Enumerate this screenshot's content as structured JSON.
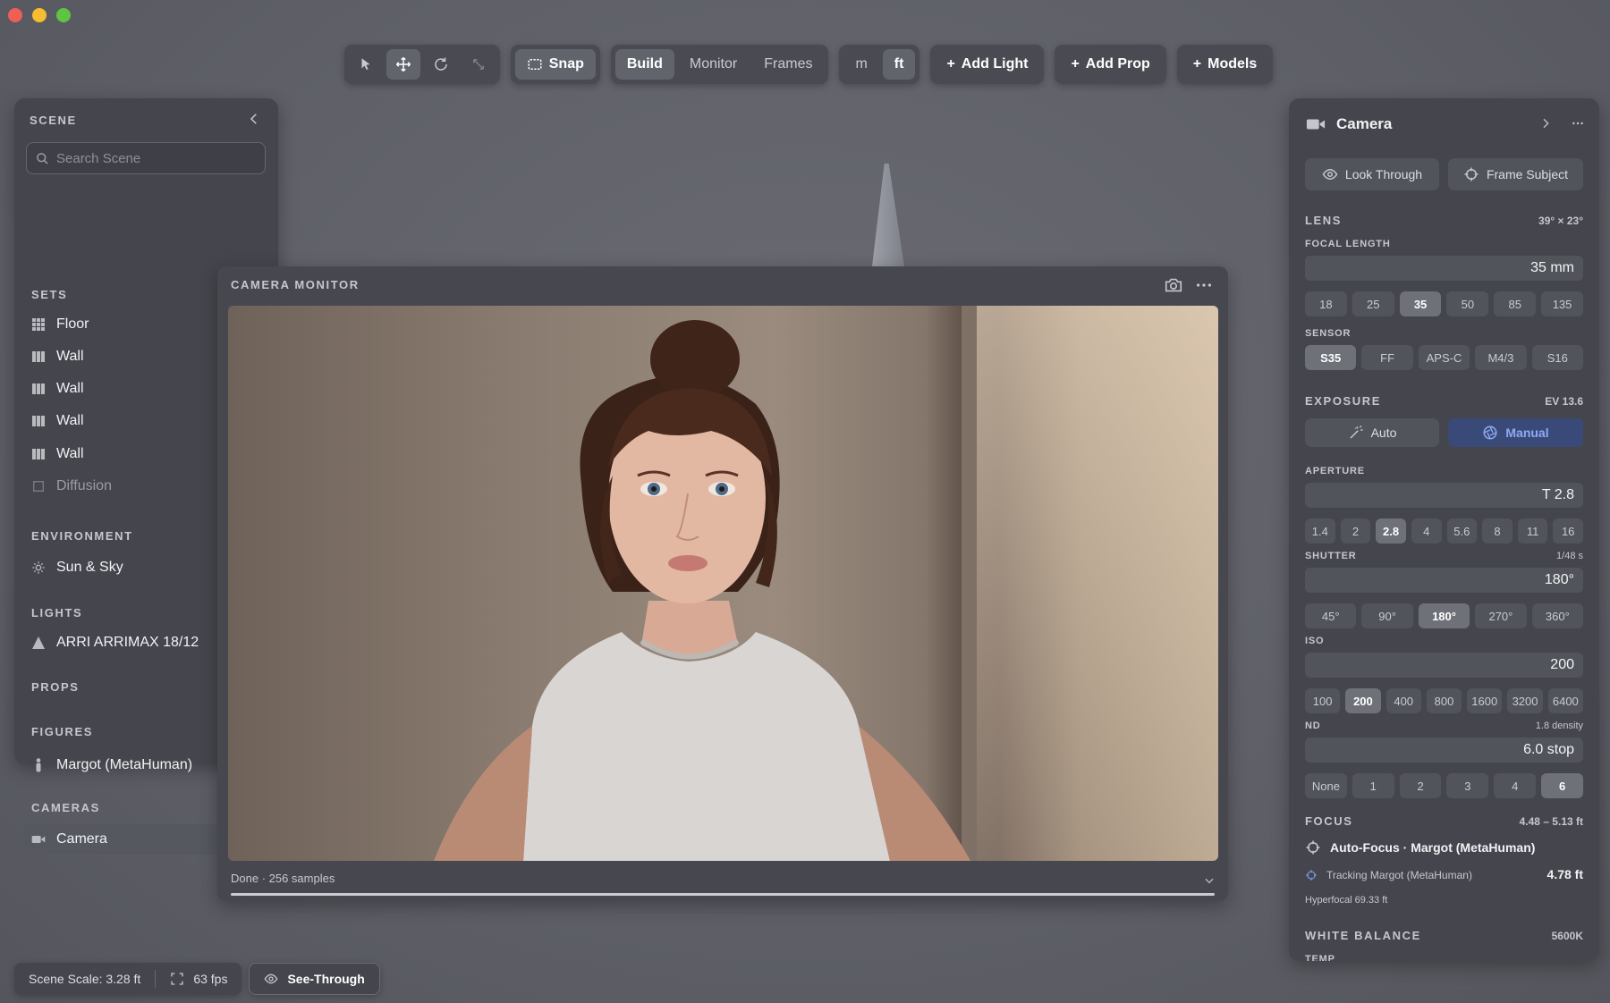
{
  "toolbar": {
    "tools": [
      {
        "name": "select",
        "icon": "cursor-arrow-icon"
      },
      {
        "name": "move",
        "icon": "move-arrows-icon"
      },
      {
        "name": "rotate",
        "icon": "rotate-icon"
      },
      {
        "name": "scale",
        "icon": "scale-icon"
      }
    ],
    "snap": "Snap",
    "modes": [
      "Build",
      "Monitor",
      "Frames"
    ],
    "units": [
      "m",
      "ft"
    ],
    "add_light": "Add Light",
    "add_prop": "Add Prop",
    "models": "Models"
  },
  "scene": {
    "title": "SCENE",
    "search_placeholder": "Search Scene",
    "sets_title": "SETS",
    "sets": [
      {
        "label": "Floor",
        "icon": "grid-icon"
      },
      {
        "label": "Wall",
        "icon": "wall-icon"
      },
      {
        "label": "Wall",
        "icon": "wall-icon"
      },
      {
        "label": "Wall",
        "icon": "wall-icon"
      },
      {
        "label": "Wall",
        "icon": "wall-icon"
      },
      {
        "label": "Diffusion",
        "icon": "square-icon"
      }
    ],
    "environment_title": "ENVIRONMENT",
    "environment": "Sun & Sky",
    "lights_title": "LIGHTS",
    "light": "ARRI ARRIMAX 18/12",
    "props_title": "PROPS",
    "figures_title": "FIGURES",
    "figure": "Margot (MetaHuman)",
    "cameras_title": "CAMERAS",
    "camera": "Camera"
  },
  "monitor": {
    "title": "CAMERA MONITOR",
    "status": "Done · 256 samples",
    "progress": 1.0
  },
  "camera_panel": {
    "title": "Camera",
    "look_through": "Look Through",
    "frame_subject": "Frame Subject",
    "lens_title": "LENS",
    "lens_meta": "39° × 23°",
    "focal_label": "FOCAL LENGTH",
    "focal_value": "35 mm",
    "focal_chips": [
      "18",
      "25",
      "35",
      "50",
      "85",
      "135"
    ],
    "focal_selected": "35",
    "sensor_label": "SENSOR",
    "sensor_chips": [
      "S35",
      "FF",
      "APS-C",
      "M4/3",
      "S16"
    ],
    "sensor_selected": "S35",
    "exposure_title": "EXPOSURE",
    "exposure_meta": "EV 13.6",
    "auto": "Auto",
    "manual": "Manual",
    "aperture_label": "APERTURE",
    "aperture_value": "T 2.8",
    "aperture_chips": [
      "1.4",
      "2",
      "2.8",
      "4",
      "5.6",
      "8",
      "11",
      "16"
    ],
    "aperture_selected": "2.8",
    "shutter_label": "SHUTTER",
    "shutter_meta": "1/48 s",
    "shutter_value": "180°",
    "shutter_chips": [
      "45°",
      "90°",
      "180°",
      "270°",
      "360°"
    ],
    "shutter_selected": "180°",
    "iso_label": "ISO",
    "iso_value": "200",
    "iso_chips": [
      "100",
      "200",
      "400",
      "800",
      "1600",
      "3200",
      "6400"
    ],
    "iso_selected": "200",
    "nd_label": "ND",
    "nd_meta": "1.8 density",
    "nd_value": "6.0 stop",
    "nd_chips": [
      "None",
      "1",
      "2",
      "3",
      "4",
      "6"
    ],
    "nd_selected": "6",
    "focus_title": "FOCUS",
    "focus_meta": "4.48 – 5.13 ft",
    "autofocus": "Auto-Focus · Margot (MetaHuman)",
    "tracking": "Tracking Margot (MetaHuman)",
    "tracking_value": "4.78 ft",
    "hyperfocal": "Hyperfocal 69.33 ft",
    "wb_title": "WHITE BALANCE",
    "wb_meta": "5600K",
    "temp_label": "TEMP"
  },
  "bottom": {
    "scale": "Scene Scale: 3.28 ft",
    "fps": "63 fps",
    "see_through": "See-Through"
  },
  "colors": {
    "background": "#5f6068",
    "panel": "#45464d",
    "accent": "#8eaaf5"
  }
}
